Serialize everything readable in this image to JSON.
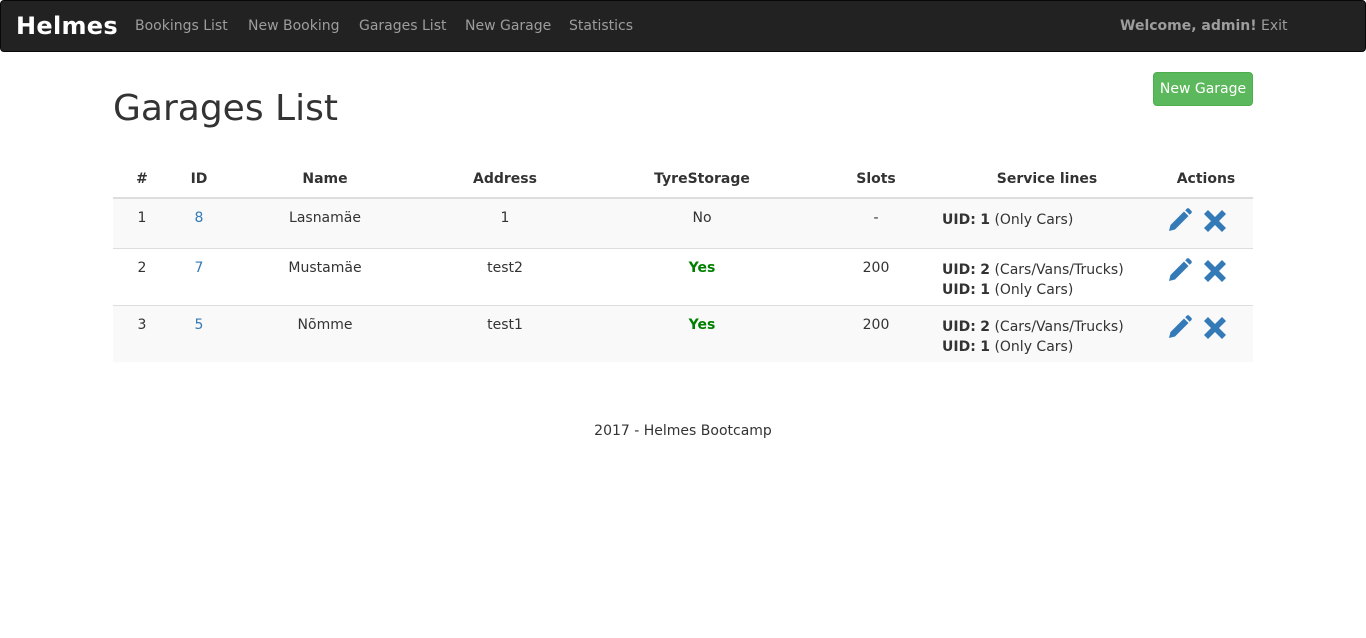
{
  "navbar": {
    "brand": "Helmes",
    "links": [
      "Bookings List",
      "New Booking",
      "Garages List",
      "New Garage",
      "Statistics"
    ],
    "welcome": "Welcome, admin!",
    "exit": "Exit"
  },
  "page": {
    "title": "Garages List",
    "new_button": "New Garage"
  },
  "table": {
    "headers": [
      "#",
      "ID",
      "Name",
      "Address",
      "TyreStorage",
      "Slots",
      "Service lines",
      "Actions"
    ],
    "rows": [
      {
        "num": "1",
        "id": "8",
        "name": "Lasnamäe",
        "address": "1",
        "tyre": "No",
        "slots": "-",
        "lines": [
          {
            "label": "UID:",
            "uid": "1",
            "desc": "(Only Cars)"
          }
        ]
      },
      {
        "num": "2",
        "id": "7",
        "name": "Mustamäe",
        "address": "test2",
        "tyre": "Yes",
        "slots": "200",
        "lines": [
          {
            "label": "UID:",
            "uid": "2",
            "desc": "(Cars/Vans/Trucks)"
          },
          {
            "label": "UID:",
            "uid": "1",
            "desc": "(Only Cars)"
          }
        ]
      },
      {
        "num": "3",
        "id": "5",
        "name": "Nõmme",
        "address": "test1",
        "tyre": "Yes",
        "slots": "200",
        "lines": [
          {
            "label": "UID:",
            "uid": "2",
            "desc": "(Cars/Vans/Trucks)"
          },
          {
            "label": "UID:",
            "uid": "1",
            "desc": "(Only Cars)"
          }
        ]
      }
    ]
  },
  "footer": "2017 - Helmes Bootcamp",
  "colors": {
    "navbar_bg": "#222222",
    "nav_text": "#9d9d9d",
    "success": "#5cb85c",
    "link": "#337ab7",
    "yes_text": "#008000"
  }
}
